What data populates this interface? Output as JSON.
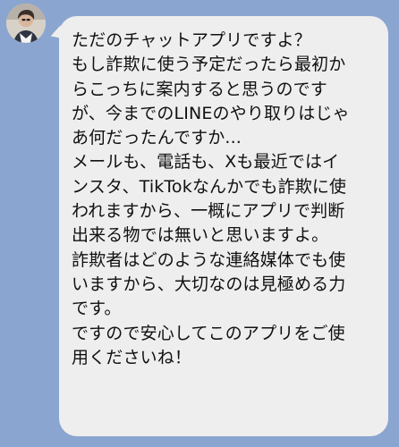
{
  "chat": {
    "sender_avatar": "user-avatar",
    "message_text": "ただのチャットアプリですよ？\nもし詐欺に使う予定だったら最初か\nらこっちに案内すると思うのです\nが、今までのLINEのやり取りはじゃ\nあ何だったんですか...\nメールも、電話も、Xも最近ではイ\nンスタ、TikTokなんかでも詐欺に使\nわれますから、一概にアプリで判断\n出来る物では無いと思いますよ。\n詐欺者はどのような連絡媒体でも使\nいますから、大切なのは見極める力\nです。\nですので安心してこのアプリをご使\n用くださいね！"
  },
  "colors": {
    "background": "#8aa5cf",
    "bubble": "#eeeeee",
    "text": "#111111"
  }
}
